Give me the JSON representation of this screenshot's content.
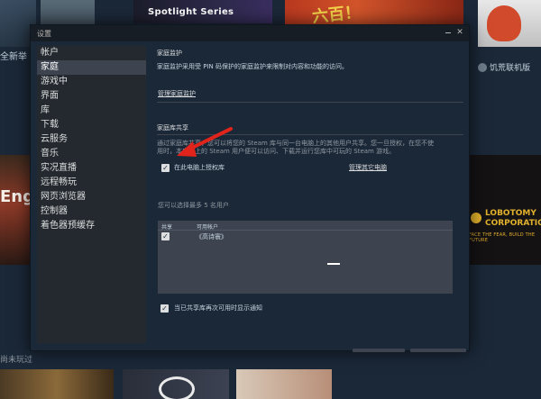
{
  "background": {
    "tile_spotlight": "Spotlight Series",
    "tile_red_text": "六百！",
    "left_caption": "全新举",
    "right_caption": "饥荒联机版",
    "left_game_text": "Eng",
    "lobotomy_title_1": "LOBOTOMY",
    "lobotomy_title_2": "CORPORATION",
    "lobotomy_tagline": "FACE THE FEAR, BUILD THE FUTURE",
    "bottom_caption": "尚未玩过"
  },
  "dialog": {
    "title": "设置",
    "minimize_label": "",
    "close_label": "✕"
  },
  "sidebar": {
    "items": [
      {
        "label": "帐户"
      },
      {
        "label": "家庭",
        "active": true
      },
      {
        "label": "游戏中"
      },
      {
        "label": "界面"
      },
      {
        "label": "库"
      },
      {
        "label": "下载"
      },
      {
        "label": "云服务"
      },
      {
        "label": "音乐"
      },
      {
        "label": "实况直播"
      },
      {
        "label": "远程畅玩"
      },
      {
        "label": "网页浏览器"
      },
      {
        "label": "控制器"
      },
      {
        "label": "着色器预缓存"
      }
    ]
  },
  "family_monitor": {
    "heading": "家庭监护",
    "description": "家庭监护采用受 PIN 码保护的家庭监护来限制对内容和功能的访问。",
    "manage_link": "管理家庭监护"
  },
  "family_library": {
    "heading": "家庭库共享",
    "description_line1": "通过家庭库共享，您可以将您的 Steam 库与同一台电脑上的其他用户共享。您一旦授权，在您不使",
    "description_line2": "用时，本电脑上的 Steam 用户便可以访问、下载并运行您库中可玩的 Steam 游戏。",
    "authorize_label": "在此电脑上授权库",
    "authorize_checked": true,
    "manage_other_link": "管理其它电脑",
    "select_limit_text": "您可以选择最多 5 名用户",
    "table": {
      "col_share": "共享",
      "col_users": "可用帐户",
      "rows": [
        {
          "checked": true,
          "user": "《高诗寰》"
        }
      ]
    },
    "notify_label": "当已共享库再次可用时显示通知",
    "notify_checked": true
  },
  "colors": {
    "window_bg": "#1b2838",
    "sidebar_bg": "#23292f",
    "active_item": "#3d4450",
    "arrow": "#e0241b"
  }
}
